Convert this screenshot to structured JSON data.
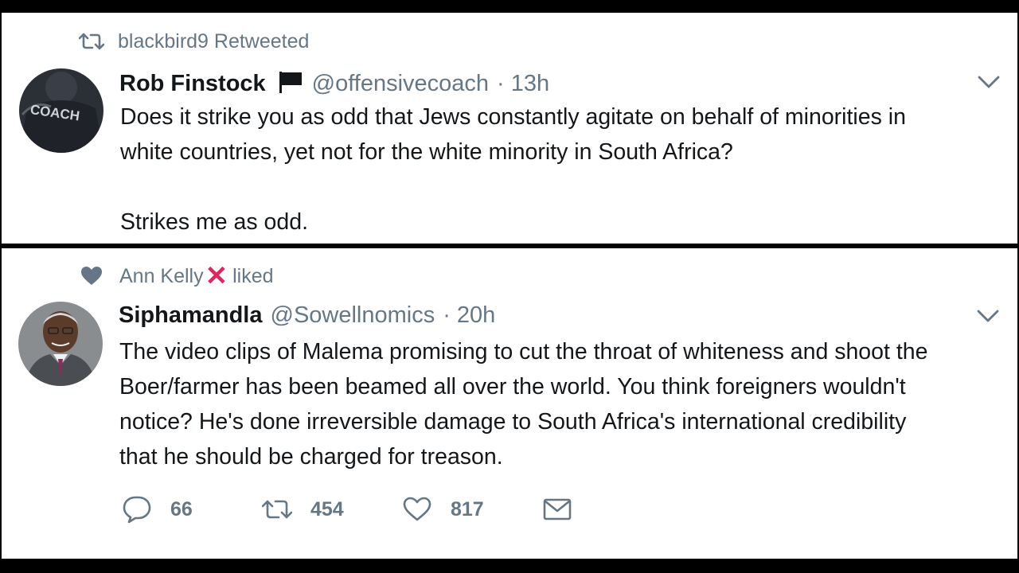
{
  "tweet1": {
    "context_label": "blackbird9 Retweeted",
    "context_icon": "retweet-icon",
    "display_name": "Rob Finstock",
    "name_badge_icon": "black-flag-icon",
    "handle": "@offensivecoach",
    "separator": "·",
    "time": "13h",
    "text": "Does it strike you as odd that Jews constantly agitate on behalf of minorities in\nwhite countries, yet not for the white minority in South Africa?\n\nStrikes me as odd.",
    "avatar_text": "COACH"
  },
  "tweet2": {
    "context_name": "Ann Kelly",
    "context_mark": "✕",
    "context_action": "liked",
    "context_icon": "heart-icon",
    "display_name": "Siphamandla",
    "handle": "@Sowellnomics",
    "separator": "·",
    "time": "20h",
    "text": "The video clips of Malema promising to cut the throat of whiteness and shoot the\nBoer/farmer has been beamed all over the world. You think foreigners wouldn't\nnotice? He's done irreversible damage to South Africa's international credibility\nthat he should be charged for treason.",
    "actions": {
      "replies": "66",
      "retweets": "454",
      "likes": "817"
    }
  },
  "colors": {
    "secondary_text": "#657786",
    "primary_text": "#14171a",
    "like_x": "#e0245e",
    "background": "#ffffff",
    "frame": "#000000"
  }
}
